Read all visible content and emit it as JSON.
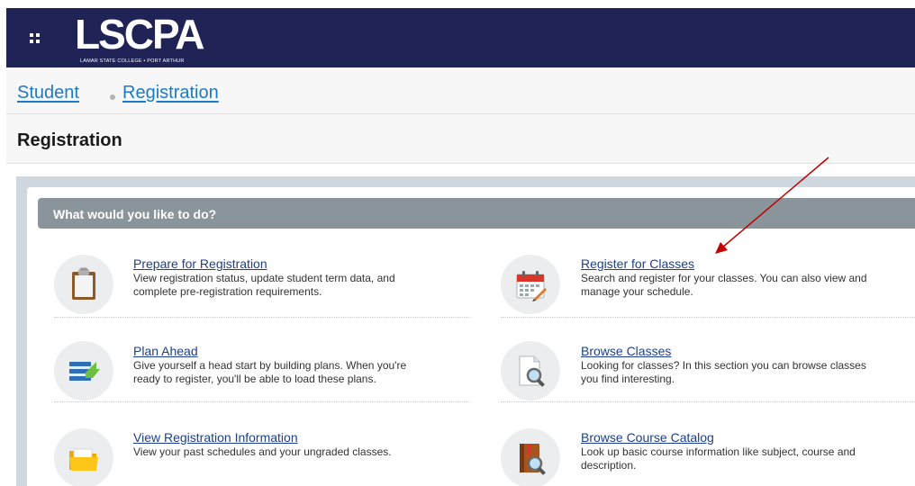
{
  "header": {
    "logo_text": "LSCPA",
    "logo_subtitle": "LAMAR STATE COLLEGE • PORT ARTHUR"
  },
  "breadcrumb": {
    "items": [
      "Student",
      "Registration"
    ]
  },
  "page": {
    "title": "Registration"
  },
  "section": {
    "header": "What would you like to do?"
  },
  "items": [
    {
      "title": "Prepare for Registration",
      "line1": "View registration status, update student term data, and",
      "line2": "complete pre-registration requirements.",
      "icon": "clipboard-icon"
    },
    {
      "title": "Register for Classes",
      "line1": "Search and register for your classes. You can also view and",
      "line2": "manage your schedule.",
      "icon": "calendar-icon"
    },
    {
      "title": "Plan Ahead",
      "line1": "Give yourself a head start by building plans. When you're",
      "line2": "ready to register, you'll be able to load these plans.",
      "icon": "plan-list-icon"
    },
    {
      "title": "Browse Classes",
      "line1": "Looking for classes? In this section you can browse classes",
      "line2": "you find interesting.",
      "icon": "document-search-icon"
    },
    {
      "title": "View Registration Information",
      "line1": "View your past schedules and your ungraded classes.",
      "line2": "",
      "icon": "folder-icon"
    },
    {
      "title": "Browse Course Catalog",
      "line1": "Look up basic course information like subject, course and",
      "line2": "description.",
      "icon": "book-search-icon"
    }
  ],
  "colors": {
    "topbar": "#1f2356",
    "link": "#1d3f8f",
    "breadcrumb_link": "#1c7ac6",
    "section_header": "#8a949b",
    "annotation_arrow": "#c00000"
  }
}
